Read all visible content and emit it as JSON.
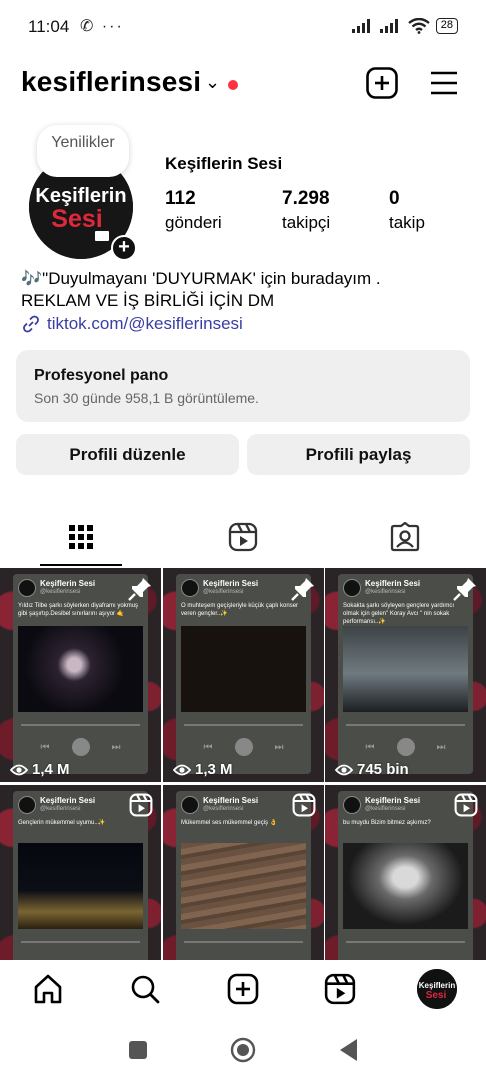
{
  "status_bar": {
    "time": "11:04",
    "left_icons": "✆ ···",
    "battery": "28"
  },
  "header": {
    "username": "kesiflerinsesi",
    "chevron": "⌄",
    "accent_dot_color": "#ff3040"
  },
  "profile": {
    "note": "Yenilikler",
    "display_name": "Keşiflerin Sesi",
    "avatar_line1": "Keşiflerin",
    "avatar_line2": "Sesi",
    "stats": [
      {
        "value": "112",
        "label": "gönderi"
      },
      {
        "value": "7.298",
        "label": "takipçi"
      },
      {
        "value": "0",
        "label": "takip"
      }
    ],
    "bio_line1": "🎶\"Duyulmayanı 'DUYURMAK' için buradayım .",
    "bio_line2": "REKLAM VE İŞ BİRLİĞİ İÇİN DM",
    "link": "tiktok.com/@kesiflerinsesi"
  },
  "professional_panel": {
    "title": "Profesyonel pano",
    "subtitle": "Son 30 günde 958,1 B görüntüleme."
  },
  "buttons": {
    "edit_profile": "Profili düzenle",
    "share_profile": "Profili paylaş"
  },
  "tabs": [
    {
      "name": "grid",
      "icon": "grid-icon",
      "active": true
    },
    {
      "name": "reels",
      "icon": "reels-icon",
      "active": false
    },
    {
      "name": "tagged",
      "icon": "tagged-icon",
      "active": false
    }
  ],
  "posts": [
    {
      "brand": "Keşiflerin Sesi",
      "handle": "@kesiflerinsesi",
      "caption": "Yıldız Tilbe şarkı söylerken diyaframı yokmuş gibi şaşırtıp.Desibel sınırlarını aşıyor 🤙",
      "views": "1,4 M",
      "badge": "pin-icon"
    },
    {
      "brand": "Keşiflerin Sesi",
      "handle": "@kesiflerinsesi",
      "caption": "O muhteşem geçişleriyle küçük çaplı konser veren gençler..✨",
      "views": "1,3 M",
      "badge": "pin-icon"
    },
    {
      "brand": "Keşiflerin Sesi",
      "handle": "@kesiflerinsesi",
      "caption": "Sokakta şarkı söyleyen gençlere yardımcı olmak için gelen\" Koray Avcı \" nin sokak performansı..✨",
      "views": "745 bin",
      "badge": "pin-icon"
    },
    {
      "brand": "Keşiflerin Sesi",
      "handle": "@kesiflerinsesi",
      "caption": "Gençlerin mükemmel uyumu..✨",
      "views": "",
      "badge": "reels-icon"
    },
    {
      "brand": "Keşiflerin Sesi",
      "handle": "@kesiflerinsesi",
      "caption": "Mükemmel ses mükemmel geçiş 👌",
      "views": "",
      "badge": "reels-icon"
    },
    {
      "brand": "Keşiflerin Sesi",
      "handle": "@kesiflerinsesi",
      "caption": "bu muydu Bizim bitmez aşkımız?",
      "views": "",
      "badge": "reels-icon"
    }
  ],
  "bottom_nav": [
    "home-icon",
    "search-icon",
    "create-icon",
    "reels-icon",
    "profile-avatar"
  ],
  "system_nav": [
    "recents-button",
    "home-button",
    "back-button"
  ]
}
